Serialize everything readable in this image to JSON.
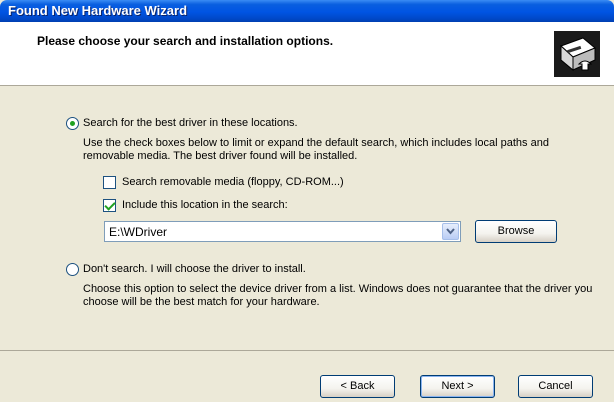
{
  "window": {
    "title": "Found New Hardware Wizard"
  },
  "header": {
    "heading": "Please choose your search and installation options.",
    "icon": "hardware-wizard-icon"
  },
  "options": {
    "search": {
      "label": "Search for the best driver in these locations.",
      "selected": true,
      "description": "Use the check boxes below to limit or expand the default search, which includes local paths and removable media. The best driver found will be installed.",
      "removable_media": {
        "label": "Search removable media (floppy, CD-ROM...)",
        "checked": false
      },
      "include_location": {
        "label": "Include this location in the search:",
        "checked": true
      },
      "location_value": "E:\\WDriver",
      "browse_label": "Browse"
    },
    "dont_search": {
      "label": "Don't search. I will choose the driver to install.",
      "selected": false,
      "description": "Choose this option to select the device driver from a list. Windows does not guarantee that the driver you choose will be the best match for your hardware."
    }
  },
  "buttons": {
    "back": "< Back",
    "next": "Next >",
    "cancel": "Cancel"
  },
  "colors": {
    "titlebar": "#0054E3",
    "dialog_bg": "#ECE9D8",
    "check_green": "#21A121"
  }
}
